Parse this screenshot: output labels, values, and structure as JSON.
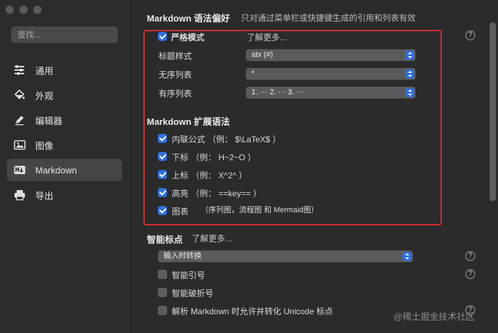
{
  "sidebar": {
    "search_placeholder": "查找...",
    "items": [
      {
        "label": "通用",
        "icon": "sliders-icon"
      },
      {
        "label": "外观",
        "icon": "paint-bucket-icon"
      },
      {
        "label": "编辑器",
        "icon": "pen-icon"
      },
      {
        "label": "图像",
        "icon": "image-icon"
      },
      {
        "label": "Markdown",
        "icon": "markdown-icon",
        "active": true
      },
      {
        "label": "导出",
        "icon": "printer-icon"
      }
    ]
  },
  "markdown_prefs": {
    "title": "Markdown 语法偏好",
    "subtitle": "只对通过菜单栏或快捷键生成的引用和列表有效",
    "strict_mode_label": "严格模式",
    "strict_mode_checked": true,
    "learn_more": "了解更多...",
    "heading_style_label": "标题样式",
    "heading_style_value": "atx (#)",
    "unordered_list_label": "无序列表",
    "unordered_list_value": "*",
    "ordered_list_label": "有序列表",
    "ordered_list_value": "1. ··· 2. ··· 3. ···"
  },
  "extended_syntax": {
    "title": "Markdown 扩展语法",
    "items": [
      {
        "label": "内联公式",
        "example": "（例： $\\LaTeX$ ）",
        "checked": true
      },
      {
        "label": "下标",
        "example": "（例： H~2~O ）",
        "checked": true
      },
      {
        "label": "上标",
        "example": "（例： X^2^ ）",
        "checked": true
      },
      {
        "label": "高亮",
        "example": "（例： ==key== ）",
        "checked": true
      },
      {
        "label": "图表",
        "example": "（序列图，流程图 和 Mermaid图）",
        "checked": true
      }
    ]
  },
  "smart_punctuation": {
    "title": "智能标点",
    "learn_more": "了解更多...",
    "mode_value": "输入时转换",
    "smart_quotes_label": "智能引号",
    "smart_dashes_label": "智能破折号",
    "unicode_label": "解析 Markdown 时允许并转化 Unicode 标点"
  },
  "help_glyph": "?",
  "watermark": "@稀土掘金技术社区",
  "colors": {
    "accent": "#2f6fe0",
    "highlight_box": "#d32f2f"
  }
}
